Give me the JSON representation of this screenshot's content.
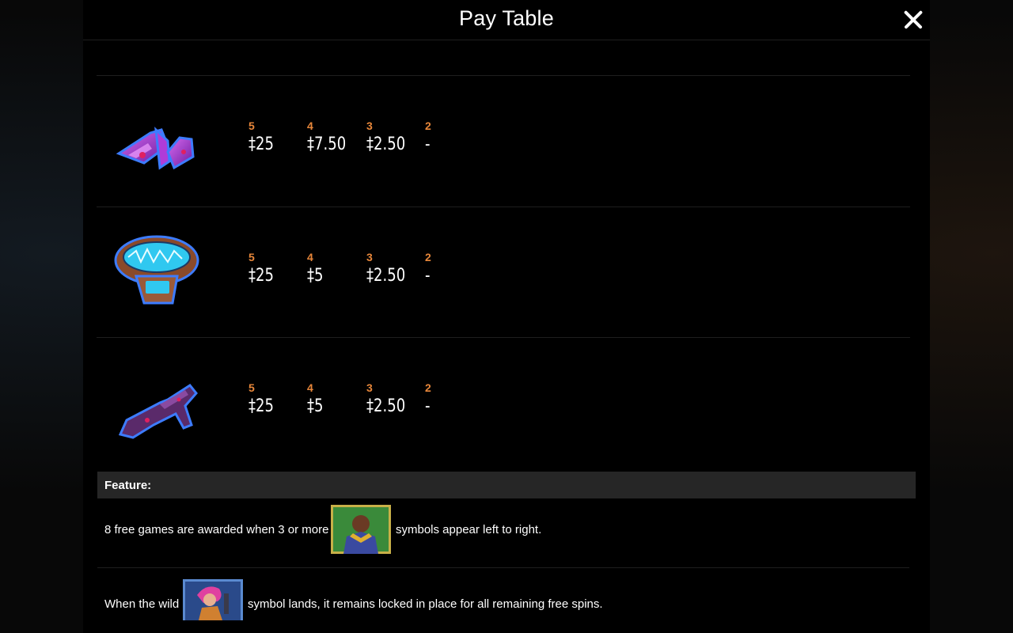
{
  "header": {
    "title": "Pay Table"
  },
  "paytable": [
    {
      "symbol_icon": "purple-spaceship-icon",
      "payouts": [
        {
          "count": "5",
          "amount": "‡25"
        },
        {
          "count": "4",
          "amount": "‡7.50"
        },
        {
          "count": "3",
          "amount": "‡2.50"
        },
        {
          "count": "2",
          "amount": "-"
        }
      ]
    },
    {
      "symbol_icon": "blue-scanner-device-icon",
      "payouts": [
        {
          "count": "5",
          "amount": "‡25"
        },
        {
          "count": "4",
          "amount": "‡5"
        },
        {
          "count": "3",
          "amount": "‡2.50"
        },
        {
          "count": "2",
          "amount": "-"
        }
      ]
    },
    {
      "symbol_icon": "purple-blaster-gun-icon",
      "payouts": [
        {
          "count": "5",
          "amount": "‡25"
        },
        {
          "count": "4",
          "amount": "‡5"
        },
        {
          "count": "3",
          "amount": "‡2.50"
        },
        {
          "count": "2",
          "amount": "-"
        }
      ]
    }
  ],
  "feature": {
    "heading": "Feature:",
    "line1_before": "8 free games are awarded when 3 or more",
    "line1_symbol": "warrior-scatter-symbol-icon",
    "line1_after": "symbols appear left to right.",
    "line2_before": "When the wild",
    "line2_symbol": "pink-hair-wild-symbol-icon",
    "line2_after": "symbol lands, it remains locked in place for all remaining free spins."
  },
  "colors": {
    "count": "#e8873a",
    "amount": "#ffffff",
    "feature_header_bg": "#262626"
  }
}
